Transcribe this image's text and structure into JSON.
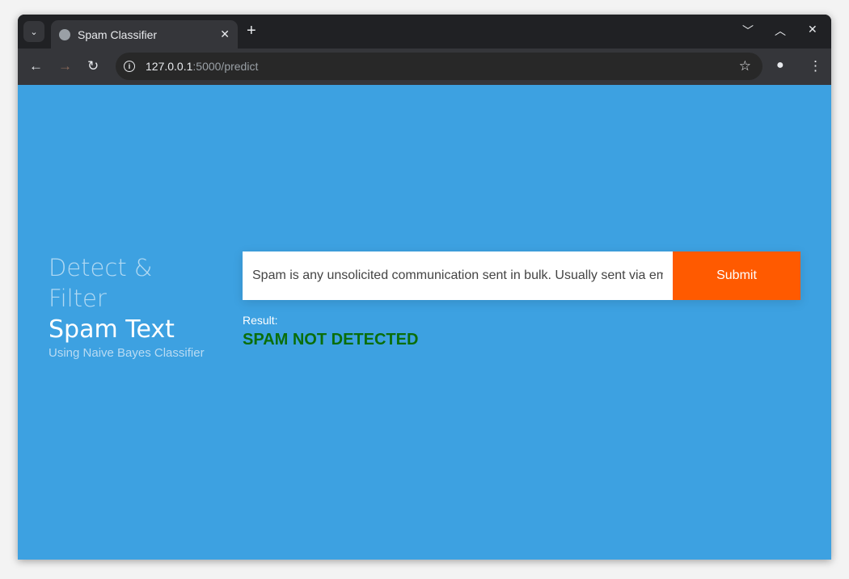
{
  "browser": {
    "tab_title": "Spam Classifier",
    "url_host": "127.0.0.1",
    "url_rest": ":5000/predict"
  },
  "hero": {
    "line1": "Detect &",
    "line2": "Filter",
    "line3": "Spam Text",
    "subtitle": "Using Naive Bayes Classifier"
  },
  "form": {
    "input_value": "Spam is any unsolicited communication sent in bulk. Usually sent via email",
    "submit_label": "Submit"
  },
  "result": {
    "label": "Result:",
    "value": "SPAM NOT DETECTED",
    "value_color": "#0a6e0a"
  },
  "colors": {
    "background": "#3da1e1",
    "button": "#ff5a00"
  }
}
